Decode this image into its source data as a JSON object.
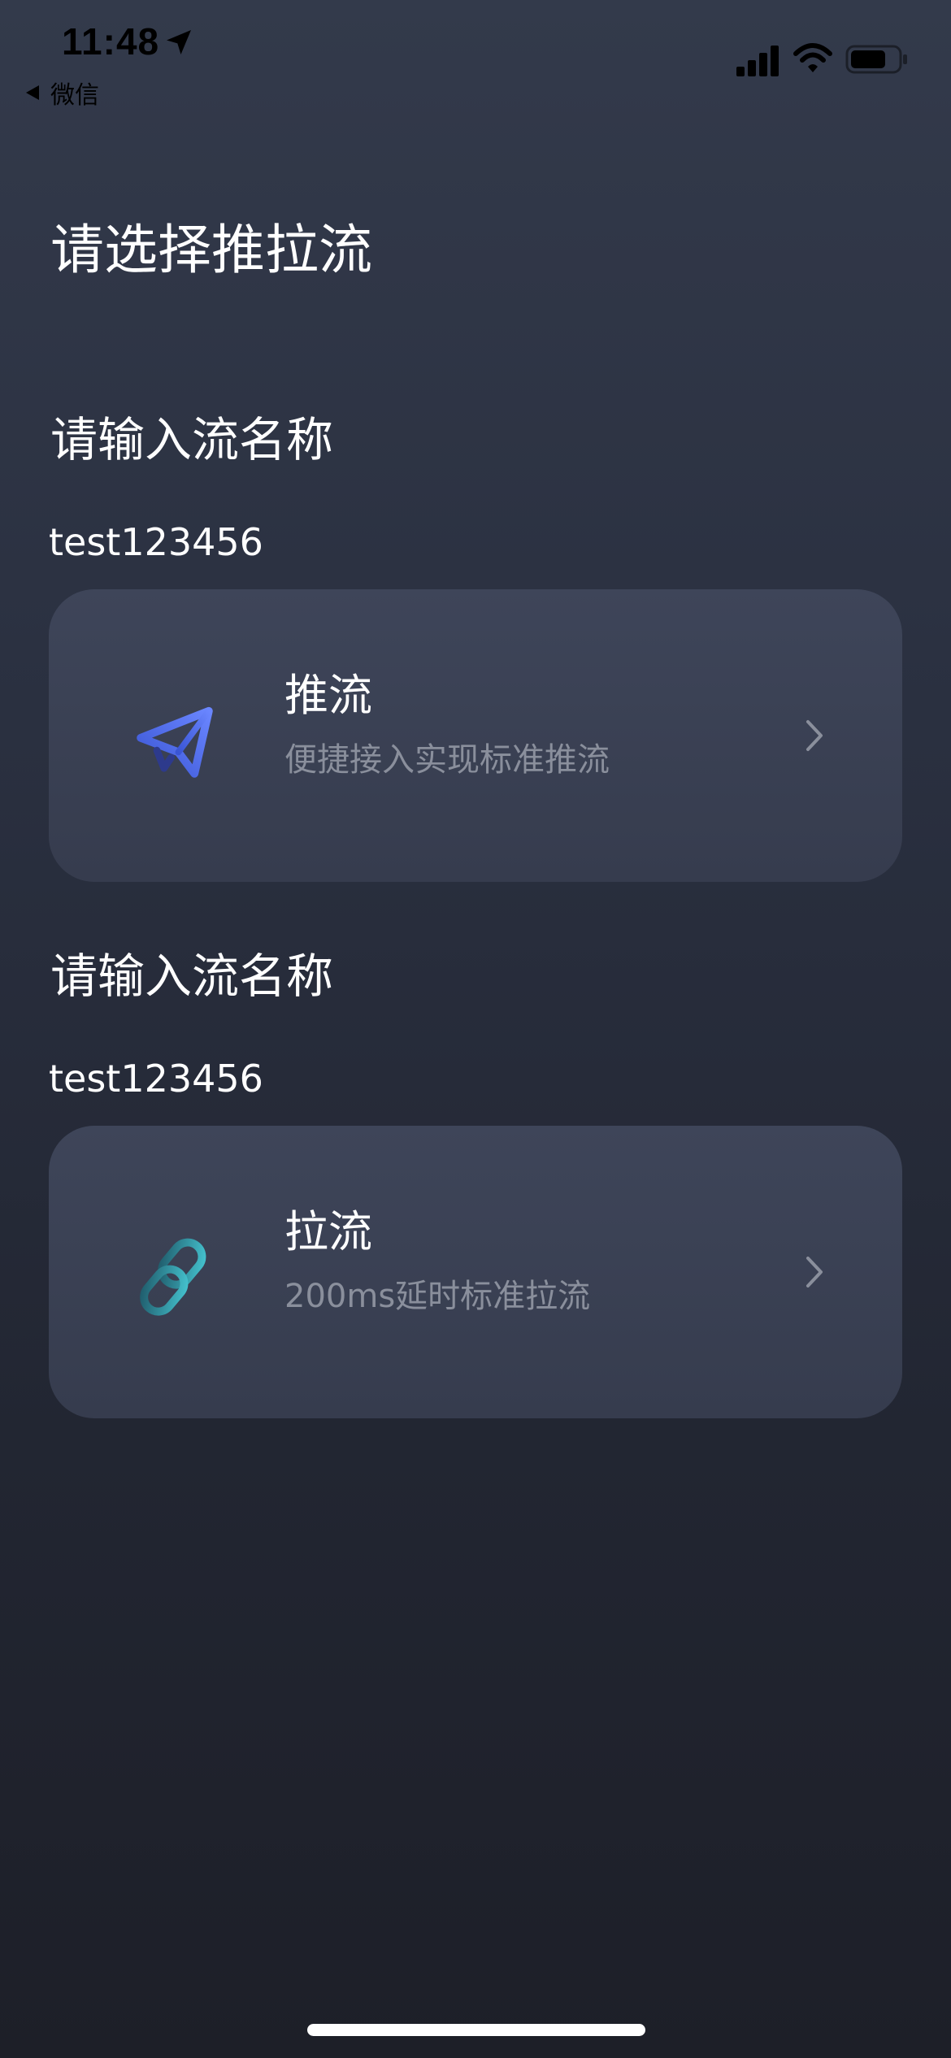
{
  "status_bar": {
    "time": "11:48",
    "back_app": "微信"
  },
  "page": {
    "title": "请选择推拉流"
  },
  "push": {
    "label": "请输入流名称",
    "stream_name": "test123456",
    "card": {
      "icon": "send-icon",
      "title": "推流",
      "subtitle": "便捷接入实现标准推流"
    }
  },
  "pull": {
    "label": "请输入流名称",
    "stream_name": "test123456",
    "card": {
      "icon": "link-icon",
      "title": "拉流",
      "subtitle": "200ms延时标准拉流"
    }
  },
  "colors": {
    "background_top": "#333a4b",
    "background_bottom": "#1d1f28",
    "card": "#3a4154",
    "subtitle": "#8a8f9c",
    "push_icon": "#4f6bea",
    "pull_icon": "#35a9b8"
  }
}
